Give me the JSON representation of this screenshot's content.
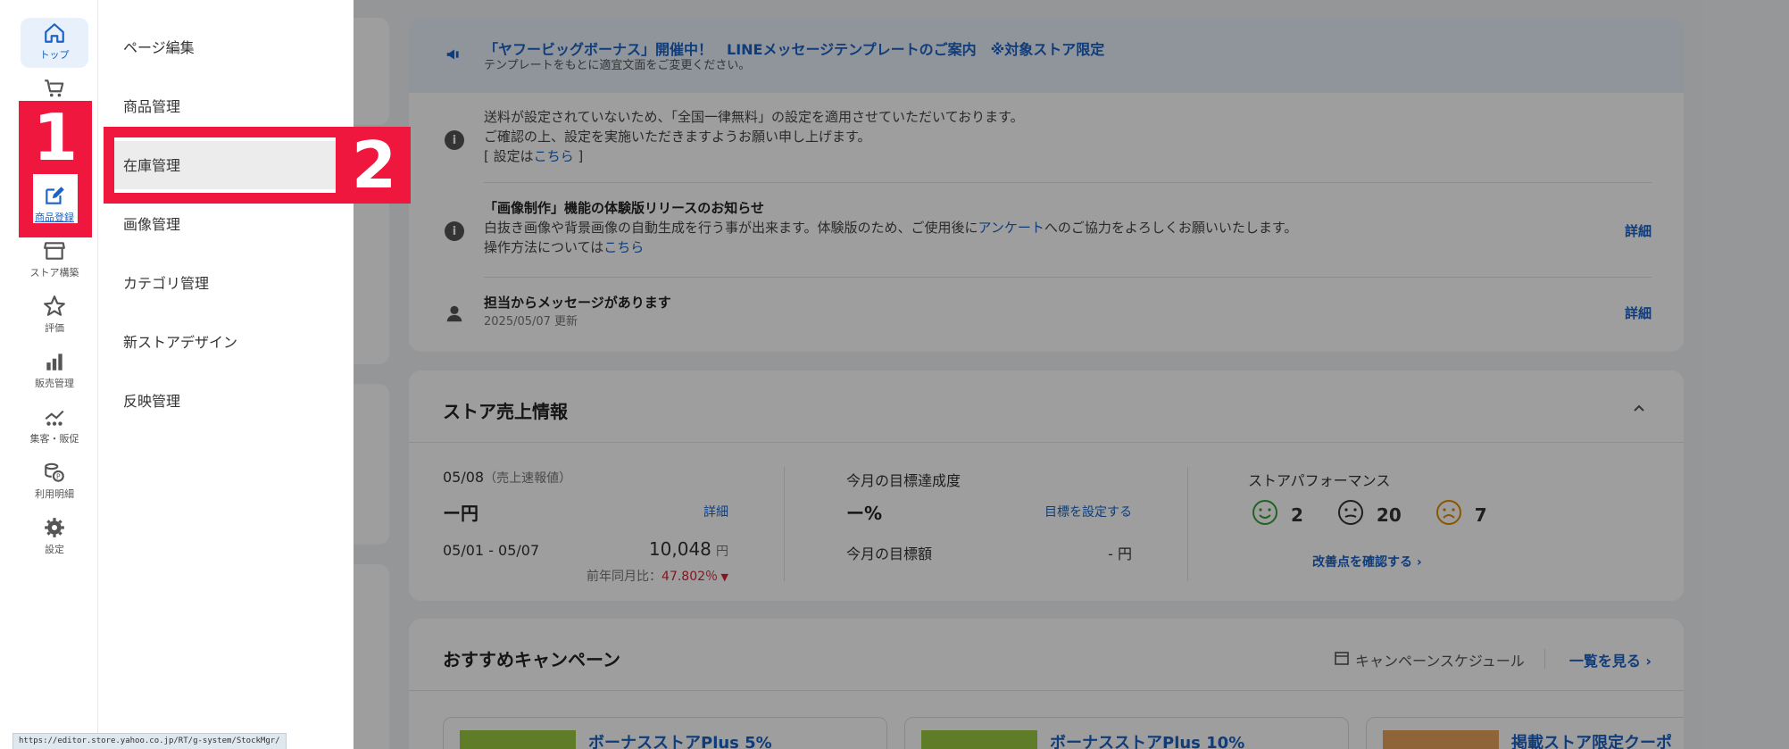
{
  "rail": {
    "items": [
      {
        "label": "トップ",
        "icon": "home-icon"
      },
      {
        "label": "",
        "icon": "cart-icon"
      },
      {
        "label": "商品登録",
        "icon": "edit-icon"
      },
      {
        "label": "ストア構築",
        "icon": "store-icon"
      },
      {
        "label": "評価",
        "icon": "star-icon"
      },
      {
        "label": "販売管理",
        "icon": "bar-chart-icon"
      },
      {
        "label": "集客・販促",
        "icon": "people-chart-icon"
      },
      {
        "label": "利用明細",
        "icon": "coins-icon"
      },
      {
        "label": "設定",
        "icon": "gear-icon"
      }
    ]
  },
  "submenu": {
    "items": [
      "ページ編集",
      "商品管理",
      "在庫管理",
      "画像管理",
      "カテゴリ管理",
      "新ストアデザイン",
      "反映管理"
    ],
    "highlighted": "在庫管理"
  },
  "annotations": {
    "step1": "1",
    "step2": "2",
    "color": "#f0173f"
  },
  "notices": {
    "banner_title": "「ヤフービッグボーナス」開催中！　LINEメッセージテンプレートのご案内　※対象ストア限定",
    "banner_sub": "テンプレートをもとに適宜文面をご変更ください。",
    "shipping_line1": "送料が設定されていないため、「全国一律無料」の設定を適用させていただいております。",
    "shipping_line2": "ご確認の上、設定を実施いただきますようお願い申し上げます。",
    "shipping_line3_pre": "[ 設定は",
    "shipping_line3_link": "こちら",
    "shipping_line3_post": " ]",
    "image_title": "「画像制作」機能の体験版リリースのお知らせ",
    "image_line1_pre": "白抜き画像や背景画像の自動生成を行う事が出来ます。体験版のため、ご使用後に",
    "image_line1_link": "アンケート",
    "image_line1_post": "へのご協力をよろしくお願いいたします。",
    "image_line2_pre": "操作方法については",
    "image_line2_link": "こちら",
    "image_detail": "詳細",
    "message_title": "担当からメッセージがあります",
    "message_date": "2025/05/07 更新",
    "message_detail": "詳細"
  },
  "sales": {
    "title": "ストア売上情報",
    "date": "05/08",
    "date_note": "（売上速報値）",
    "today_value": "ー円",
    "today_detail": "詳細",
    "period": "05/01 - 05/07",
    "period_value": "10,048",
    "period_unit": "円",
    "yoy_label": "前年同月比：",
    "yoy_value": "47.802％",
    "goal_title": "今月の目標達成度",
    "goal_value": "ー%",
    "goal_set": "目標を設定する",
    "goal_amount_label": "今月の目標額",
    "goal_amount_value": "- 円",
    "perf_title": "ストアパフォーマンス",
    "perf_good": "2",
    "perf_neutral": "20",
    "perf_bad": "7",
    "perf_link": "改善点を確認する ›"
  },
  "campaign": {
    "title": "おすすめキャンペーン",
    "schedule": "キャンペーンスケジュール",
    "view_all": "一覧を見る ›",
    "cards": [
      "ボーナスストアPlus 5%",
      "ボーナスストアPlus 10%",
      "掲載ストア限定クーポ"
    ]
  },
  "status_url": "https://editor.store.yahoo.co.jp/RT/g-system/StockMgr/"
}
